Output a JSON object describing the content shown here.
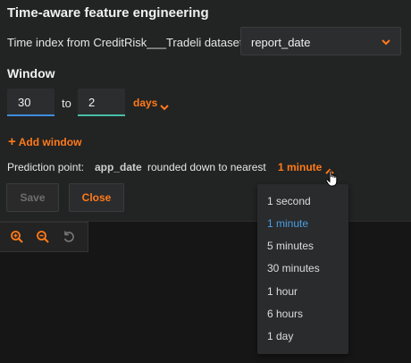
{
  "title": "Time-aware feature engineering",
  "time_index": {
    "label": "Time index from CreditRisk___Tradeli dataset:",
    "selected": "report_date"
  },
  "window": {
    "section_label": "Window",
    "from_value": "30",
    "to_label": "to",
    "to_value": "2",
    "unit": "days"
  },
  "add_window_label": "Add window",
  "prediction_point": {
    "label": "Prediction point:",
    "column": "app_date",
    "rounded_text": "rounded down to nearest",
    "unit": "1 minute"
  },
  "buttons": {
    "save": "Save",
    "close": "Close"
  },
  "toolbar": {
    "icons": [
      "zoom-in-icon",
      "zoom-out-icon",
      "reset-icon"
    ]
  },
  "dropdown": {
    "options": [
      "1 second",
      "1 minute",
      "5 minutes",
      "30 minutes",
      "1 hour",
      "6 hours",
      "1 day"
    ],
    "selected": "1 minute"
  },
  "colors": {
    "accent": "#ff7a1a",
    "selected_option": "#4a9fe6",
    "from_underline": "#3e8ddd",
    "to_underline": "#47bfa6"
  }
}
